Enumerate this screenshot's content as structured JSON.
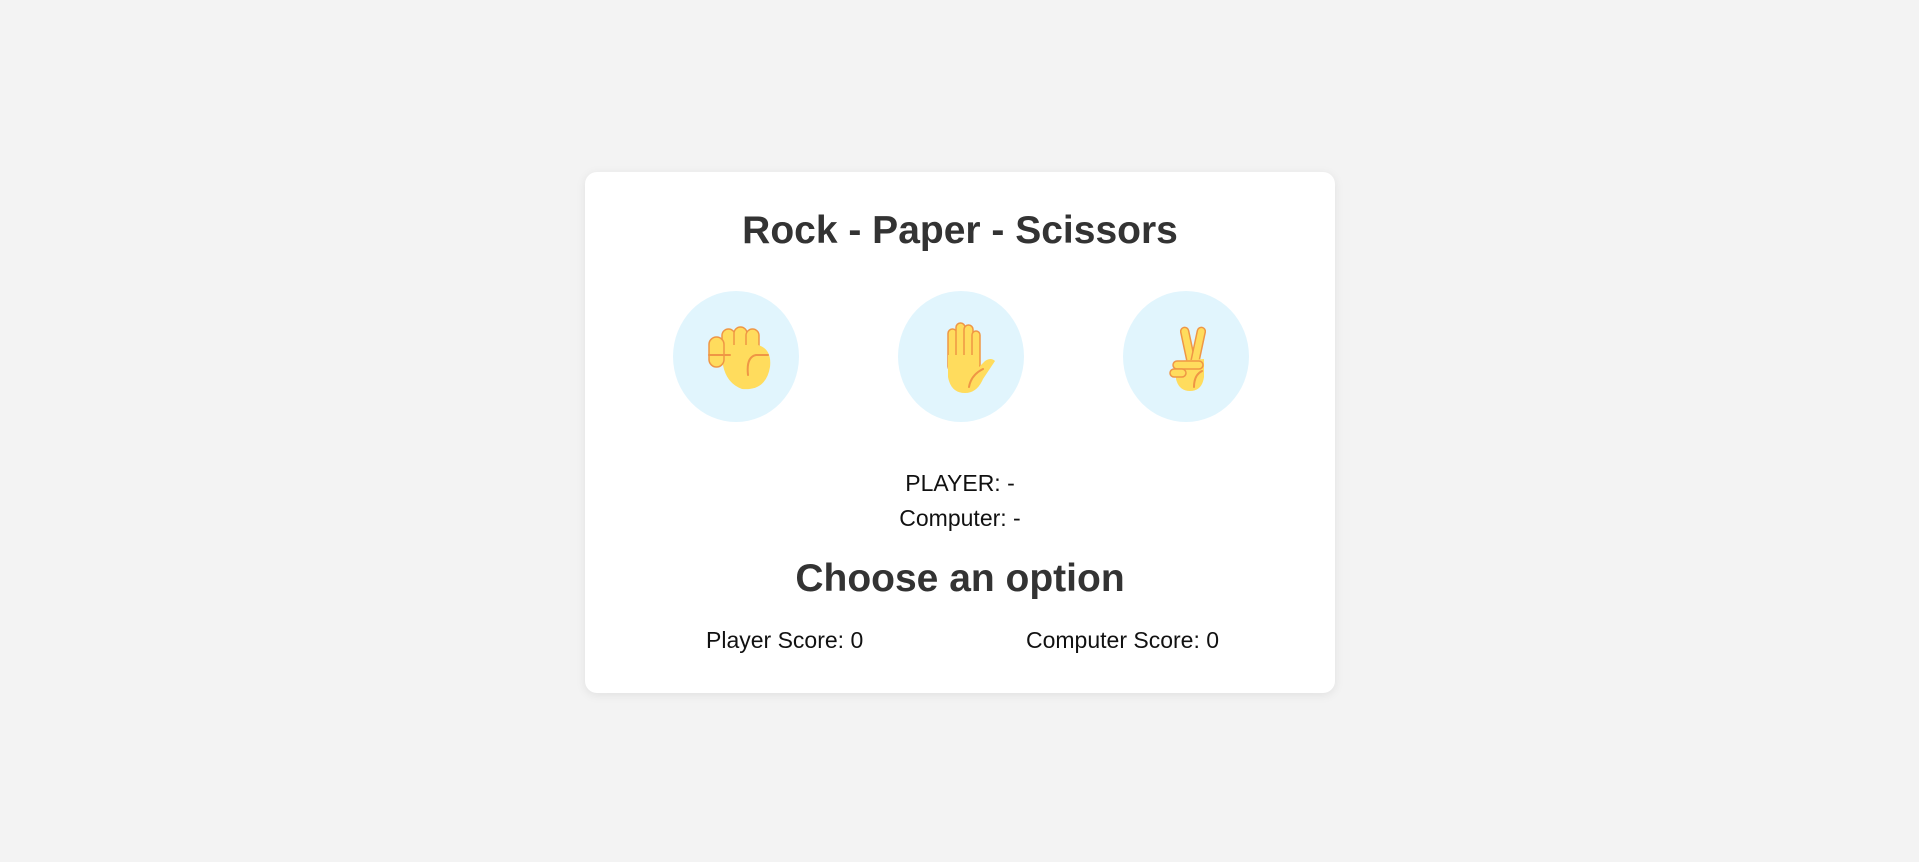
{
  "game": {
    "title": "Rock - Paper - Scissors",
    "choices": [
      {
        "id": "rock",
        "icon": "raised-fist-icon"
      },
      {
        "id": "paper",
        "icon": "raised-hand-icon"
      },
      {
        "id": "scissors",
        "icon": "victory-hand-icon"
      }
    ],
    "player_choice": "PLAYER: -",
    "computer_choice": "Computer: -",
    "result_message": "Choose an option",
    "player_score": "Player Score: 0",
    "computer_score": "Computer Score: 0"
  },
  "colors": {
    "background": "#f3f3f3",
    "card": "#ffffff",
    "choice_circle": "#e1f5fd",
    "emoji_skin": "#ffdc5d",
    "emoji_line": "#ef9645",
    "heading_text": "#333333"
  }
}
